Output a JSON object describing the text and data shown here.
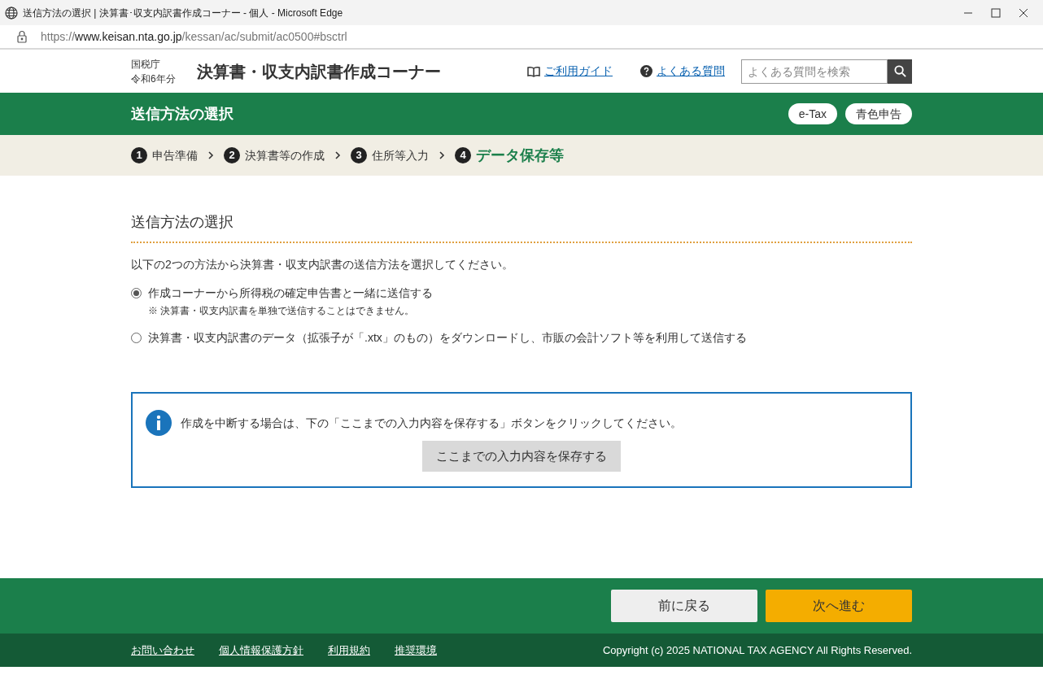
{
  "browser": {
    "title": "送信方法の選択 | 決算書･収支内訳書作成コーナー - 個人 - Microsoft Edge",
    "url": {
      "scheme": "https://",
      "host": "www.keisan.nta.go.jp",
      "path": "/kessan/ac/submit/ac0500#bsctrl"
    }
  },
  "header": {
    "agency": "国税庁",
    "year": "令和6年分",
    "site_title": "決算書・収支内訳書作成コーナー",
    "links": [
      {
        "kind": "guide",
        "label": "ご利用ガイド"
      },
      {
        "kind": "faq",
        "label": "よくある質問"
      }
    ],
    "search": {
      "placeholder": "よくある質問を検索"
    }
  },
  "page_band": {
    "title": "送信方法の選択",
    "badges": [
      "e-Tax",
      "青色申告"
    ]
  },
  "steps": [
    {
      "number": "1",
      "label": "申告準備",
      "selected": false
    },
    {
      "number": "2",
      "label": "決算書等の作成",
      "selected": false
    },
    {
      "number": "3",
      "label": "住所等入力",
      "selected": false
    },
    {
      "number": "4",
      "label": "データ保存等",
      "selected": true
    }
  ],
  "section": {
    "heading": "送信方法の選択",
    "intro": "以下の2つの方法から決算書・収支内訳書の送信方法を選択してください。",
    "options": [
      {
        "label": "作成コーナーから所得税の確定申告書と一緒に送信する",
        "note": "※ 決算書・収支内訳書を単独で送信することはできません。",
        "selected": true
      },
      {
        "label": "決算書・収支内訳書のデータ（拡張子が「.xtx」のもの）をダウンロードし、市販の会計ソフト等を利用して送信する",
        "selected": false
      }
    ]
  },
  "info_box": {
    "message": "作成を中断する場合は、下の「ここまでの入力内容を保存する」ボタンをクリックしてください。",
    "button": "ここまでの入力内容を保存する"
  },
  "nav_buttons": {
    "back": "前に戻る",
    "next": "次へ進む"
  },
  "footer": {
    "links": [
      "お問い合わせ",
      "個人情報保護方針",
      "利用規約",
      "推奨環境"
    ],
    "copyright": "Copyright (c) 2025 NATIONAL TAX AGENCY All Rights Reserved."
  }
}
